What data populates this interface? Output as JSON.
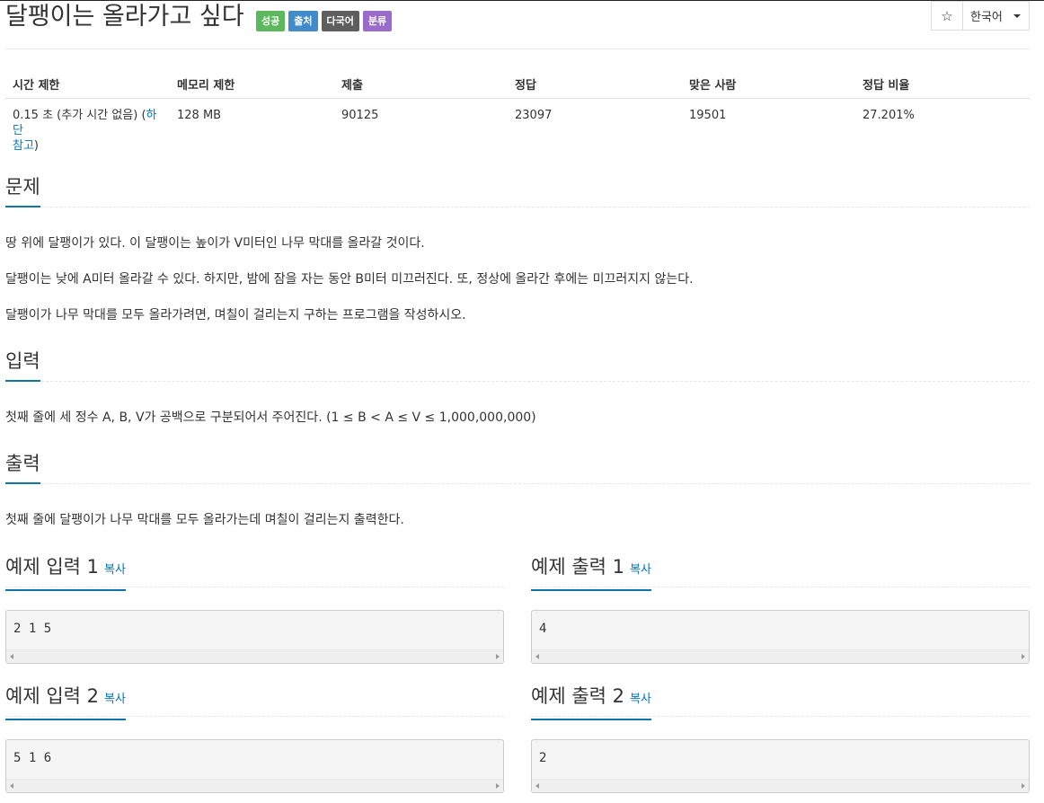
{
  "problem": {
    "title": "달팽이는 올라가고 싶다",
    "labels": [
      {
        "text": "성공",
        "color": "#5cb85c"
      },
      {
        "text": "출처",
        "color": "#428bca"
      },
      {
        "text": "다국어",
        "color": "#5e5e5e"
      },
      {
        "text": "분류",
        "color": "#9b6bcc"
      }
    ]
  },
  "toolbar": {
    "star_icon": "☆",
    "language": "한국어"
  },
  "info": {
    "headers": [
      "시간 제한",
      "메모리 제한",
      "제출",
      "정답",
      "맞은 사람",
      "정답 비율"
    ],
    "time_limit": "0.15 초 (추가 시간 없음) (",
    "time_link_1": "하단",
    "time_link_2": "참고",
    "time_close": ")",
    "memory": "128 MB",
    "submissions": "90125",
    "accepted": "23097",
    "solvers": "19501",
    "ratio": "27.201%"
  },
  "sections": {
    "problem_heading": "문제",
    "problem_paragraphs": [
      "땅 위에 달팽이가 있다. 이 달팽이는 높이가 V미터인 나무 막대를 올라갈 것이다.",
      "달팽이는 낮에 A미터 올라갈 수 있다. 하지만, 밤에 잠을 자는 동안 B미터 미끄러진다. 또, 정상에 올라간 후에는 미끄러지지 않는다.",
      "달팽이가 나무 막대를 모두 올라가려면, 며칠이 걸리는지 구하는 프로그램을 작성하시오."
    ],
    "input_heading": "입력",
    "input_text": "첫째 줄에 세 정수 A, B, V가 공백으로 구분되어서 주어진다. (1 ≤ B < A ≤ V ≤ 1,000,000,000)",
    "output_heading": "출력",
    "output_text": "첫째 줄에 달팽이가 나무 막대를 모두 올라가는데 며칠이 걸리는지 출력한다."
  },
  "samples": {
    "copy_label": "복사",
    "input1_title": "예제 입력 1",
    "input1": "2 1 5",
    "output1_title": "예제 출력 1",
    "output1": "4",
    "input2_title": "예제 입력 2",
    "input2": "5 1 6",
    "output2_title": "예제 출력 2",
    "output2": "2"
  }
}
